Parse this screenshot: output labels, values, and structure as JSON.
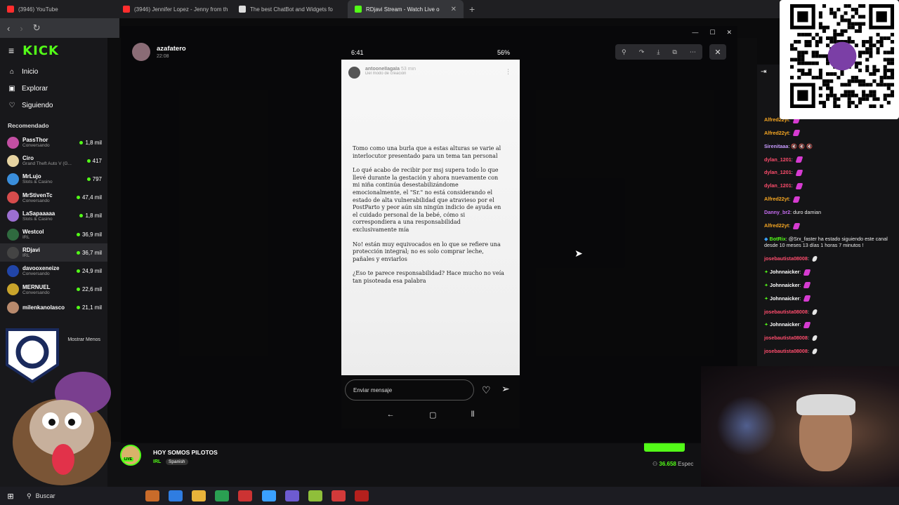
{
  "browser": {
    "tabs": [
      {
        "title": "(3946) YouTube",
        "color": "#ff2d2d",
        "active": false
      },
      {
        "title": "(3946) Jennifer Lopez - Jenny from th",
        "color": "#ff2d2d",
        "active": false
      },
      {
        "title": "The best ChatBot and Widgets fo",
        "color": "#dddddd",
        "active": false
      },
      {
        "title": "RDjavi Stream - Watch Live o",
        "color": "#53fc18",
        "active": true
      }
    ]
  },
  "kick": {
    "logo": "KICK",
    "nav": [
      {
        "label": "Inicio",
        "icon": "home-icon",
        "glyph": "⌂"
      },
      {
        "label": "Explorar",
        "icon": "browse-icon",
        "glyph": "▣"
      },
      {
        "label": "Siguiendo",
        "icon": "heart-icon",
        "glyph": "♡"
      }
    ],
    "recommended_title": "Recomendado",
    "channels": [
      {
        "name": "PassThor",
        "category": "Conversando",
        "viewers": "1,8 mil",
        "color": "#c34fa3"
      },
      {
        "name": "Ciro",
        "category": "Grand Theft Auto V (G...",
        "viewers": "417",
        "color": "#e6d3a1"
      },
      {
        "name": "MrLujo",
        "category": "Slots & Casino",
        "viewers": "797",
        "color": "#3a8edb"
      },
      {
        "name": "MrStivenTc",
        "category": "Conversando",
        "viewers": "47,4 mil",
        "color": "#d64c4c"
      },
      {
        "name": "LaSapaaaaa",
        "category": "Slots & Casino",
        "viewers": "1,8 mil",
        "color": "#9c6fd1"
      },
      {
        "name": "Westcol",
        "category": "IRL",
        "viewers": "36,9 mil",
        "color": "#2f6a3f"
      },
      {
        "name": "RDjavi",
        "category": "IRL",
        "viewers": "36,7 mil",
        "color": "#444444"
      },
      {
        "name": "davooxeneize",
        "category": "Conversando",
        "viewers": "24,9 mil",
        "color": "#2145a8"
      },
      {
        "name": "MERNUEL",
        "category": "Conversando",
        "viewers": "22,6 mil",
        "color": "#c9a42b"
      },
      {
        "name": "milenkanolasco",
        "category": "",
        "viewers": "21,1 mil",
        "color": "#b88a6d"
      }
    ],
    "show_less": "Mostrar Menos"
  },
  "stream_info": {
    "title": "HOY SOMOS PILOTOS",
    "category": "IRL",
    "language": "Spanish",
    "live_badge": "LIVE",
    "viewers": "36.658",
    "viewers_suffix": "Espec"
  },
  "overlay": {
    "username": "azafatero",
    "time": "22:08",
    "phone": {
      "time": "6:41",
      "battery": "56%",
      "story_user": "antoonellagala",
      "story_age": "53 min",
      "story_subtitle": "Del modo de creación",
      "paragraphs": [
        "Tomo como una burla que a estas alturas se varie al interlocutor presentado para un tema tan personal",
        "Lo qué acabo de recibir por msj supera todo lo que llevé durante la gestación y ahora nuevamente con mi niña continúa desestabilizándome emocionalmente, el \"Sr.\" no está considerando el estado de alta vulnerabilidad que atravieso por el PostParto y peor aún sin ningún indicio de ayuda en el cuidado personal de la bebé, cómo si correspondiera a una responsabilidad exclusivamente mía",
        "No! están muy equivocados en lo que se refiere una protección integral; no es solo comprar leche, pañales y enviarlos",
        "¿Eso te parece responsabilidad? Hace mucho no veía tan pisoteada esa palabra"
      ],
      "message_placeholder": "Enviar mensaje"
    }
  },
  "chat": {
    "messages": [
      {
        "user": "Alfred22yt",
        "color": "#f5a623",
        "text": "",
        "emotes": "e"
      },
      {
        "user": "Alfred22yt",
        "color": "#f5a623",
        "text": "",
        "emotes": "e"
      },
      {
        "user": "Sirenitaaa",
        "color": "#c89bff",
        "text": "🔇 🔇 🔇",
        "emotes": ""
      },
      {
        "user": "dylan_1201",
        "color": "#ff4d6d",
        "text": "",
        "emotes": "e"
      },
      {
        "user": "dylan_1201",
        "color": "#ff4d6d",
        "text": "",
        "emotes": "e"
      },
      {
        "user": "dylan_1201",
        "color": "#ff4d6d",
        "text": "",
        "emotes": "e"
      },
      {
        "user": "Alfred22yt",
        "color": "#f5a623",
        "text": "",
        "emotes": "e"
      },
      {
        "user": "Danny_br2",
        "color": "#c56cf0",
        "text": "duro damian",
        "emotes": ""
      },
      {
        "user": "Alfred22yt",
        "color": "#f5a623",
        "text": "",
        "emotes": "e"
      },
      {
        "user": "BotRix",
        "color": "#53fc18",
        "text": "@Srx_faster ha estado siguiendo este canal desde 10 meses 13 días 1 horas 7 minutos !",
        "emotes": ""
      },
      {
        "user": "josebautista08008",
        "color": "#ff4d6d",
        "text": "",
        "emotes": "w"
      },
      {
        "user": "Johnnaicker",
        "color": "#ffffff",
        "text": "",
        "emotes": "e"
      },
      {
        "user": "Johnnaicker",
        "color": "#ffffff",
        "text": "",
        "emotes": "e"
      },
      {
        "user": "Johnnaicker",
        "color": "#ffffff",
        "text": "",
        "emotes": "e"
      },
      {
        "user": "josebautista08008",
        "color": "#ff4d6d",
        "text": "",
        "emotes": "w"
      },
      {
        "user": "Johnnaicker",
        "color": "#ffffff",
        "text": "",
        "emotes": "e"
      },
      {
        "user": "josebautista08008",
        "color": "#ff4d6d",
        "text": "",
        "emotes": "w"
      },
      {
        "user": "josebautista08008",
        "color": "#ff4d6d",
        "text": "",
        "emotes": "w"
      }
    ]
  },
  "taskbar": {
    "search_label": "Buscar"
  }
}
